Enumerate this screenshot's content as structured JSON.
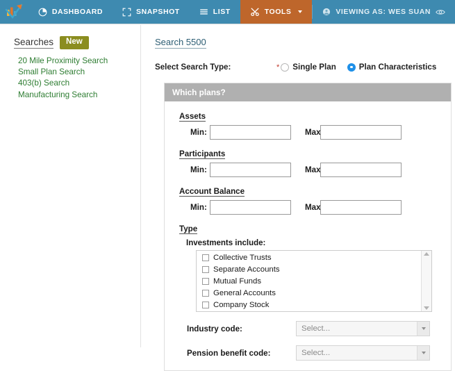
{
  "navbar": {
    "logo_name": "bar-chart-check-logo",
    "items": [
      {
        "label": "DASHBOARD",
        "icon": "pie-chart-icon",
        "active": false
      },
      {
        "label": "SNAPSHOT",
        "icon": "crop-frame-icon",
        "active": false
      },
      {
        "label": "LIST",
        "icon": "list-lines-icon",
        "active": false
      },
      {
        "label": "TOOLS",
        "icon": "tools-wrench-icon",
        "active": true
      }
    ],
    "viewing_as": {
      "label": "VIEWING AS: WES SUAN",
      "user_icon": "user-circle-icon",
      "eye_icon": "eye-icon"
    },
    "background_color": "#3e8ab0",
    "active_color": "#be662b"
  },
  "sidebar": {
    "title": "Searches",
    "new_badge": "New",
    "new_badge_color": "#8b8d1f",
    "link_color": "#2e7d32",
    "links": [
      "20 Mile Proximity Search",
      "Small Plan Search",
      "403(b) Search",
      "Manufacturing Search"
    ]
  },
  "main": {
    "page_title": "Search 5500",
    "search_type": {
      "label": "Select Search Type:",
      "required_marker": "*",
      "options": [
        {
          "label": "Single Plan",
          "selected": false
        },
        {
          "label": "Plan Characteristics",
          "selected": true
        }
      ],
      "selected_color": "#1e90e8"
    },
    "panel": {
      "header": "Which plans?",
      "header_color": "#b0b0b0",
      "assets": {
        "legend": "Assets",
        "min_label": "Min:",
        "max_label": "Max:",
        "min_value": "",
        "max_value": ""
      },
      "participants": {
        "legend": "Participants",
        "min_label": "Min:",
        "max_label": "Max:",
        "min_value": "",
        "max_value": ""
      },
      "account_balance": {
        "legend": "Account Balance",
        "min_label": "Min:",
        "max_label": "Max:",
        "min_value": "",
        "max_value": ""
      },
      "type": {
        "legend": "Type",
        "sub_label": "Investments include:",
        "items": [
          {
            "label": "Collective Trusts",
            "checked": false
          },
          {
            "label": "Separate Accounts",
            "checked": false
          },
          {
            "label": "Mutual Funds",
            "checked": false
          },
          {
            "label": "General Accounts",
            "checked": false
          },
          {
            "label": "Company Stock",
            "checked": false
          }
        ]
      },
      "industry_code": {
        "label": "Industry code:",
        "value": "Select..."
      },
      "pension_benefit_code": {
        "label": "Pension benefit code:",
        "value": "Select..."
      }
    }
  }
}
